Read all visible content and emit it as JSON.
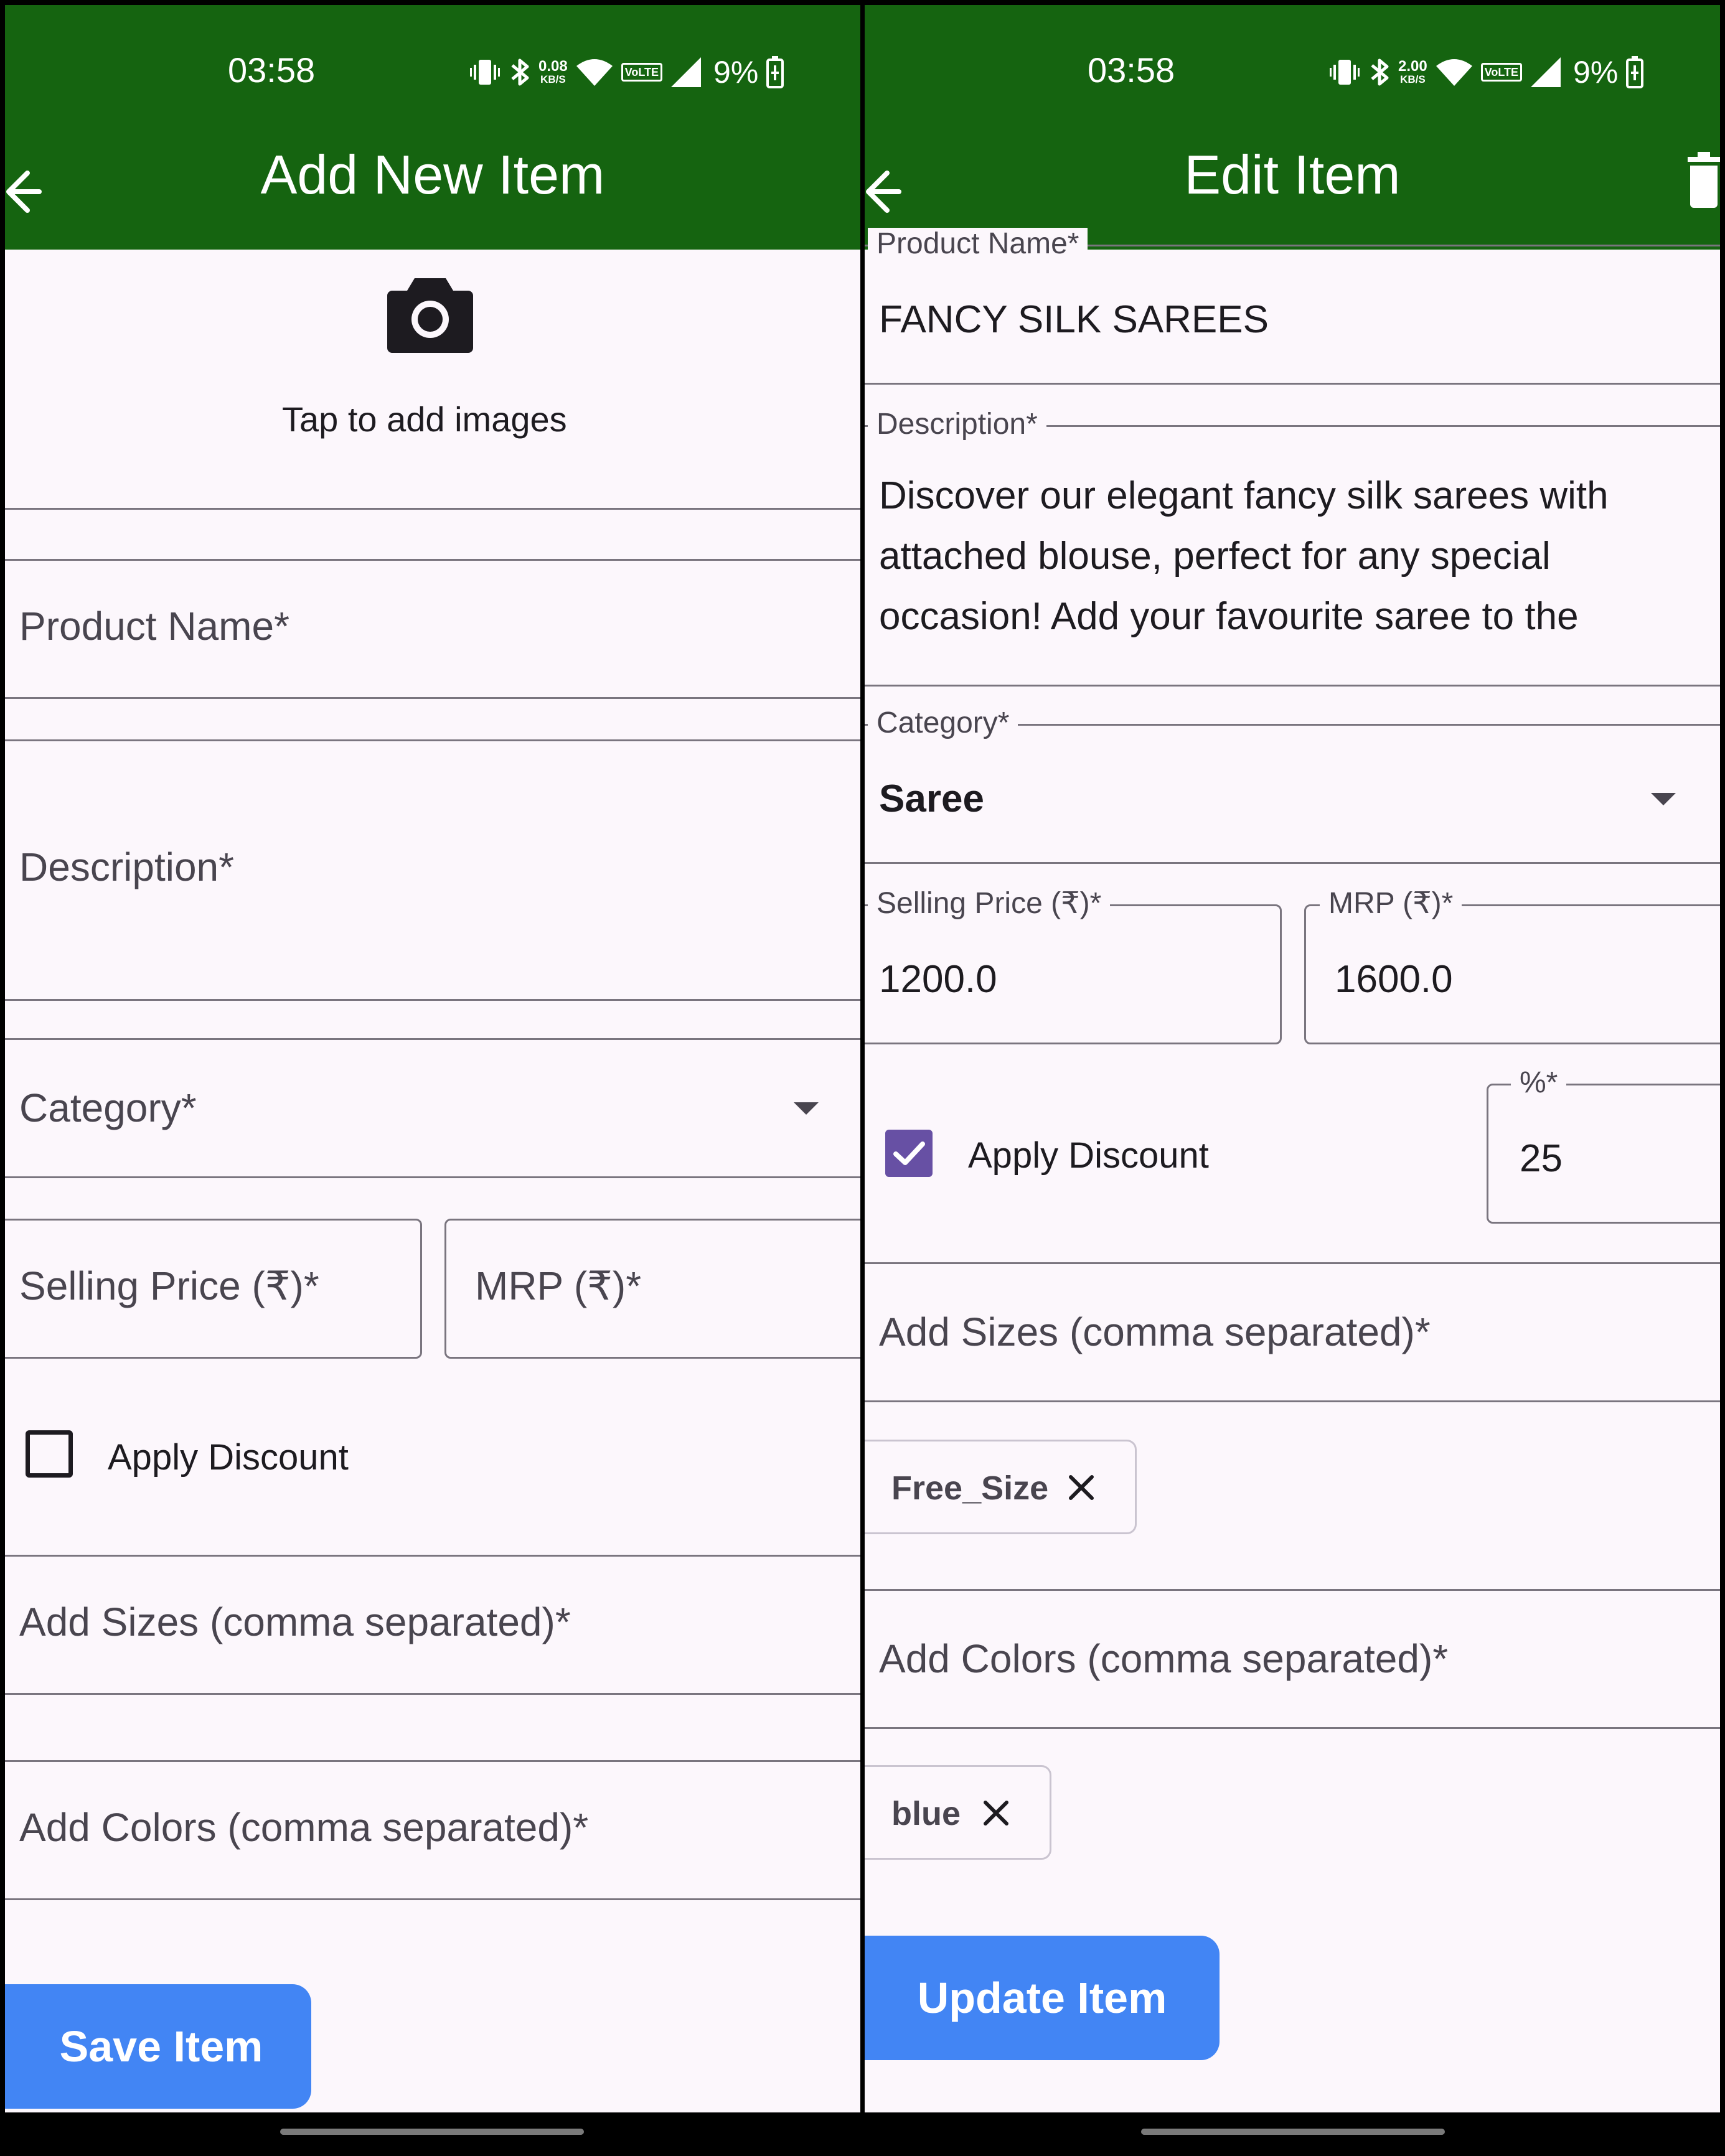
{
  "status_bar": {
    "time": "03:58",
    "left_speed": {
      "value": "0.08",
      "unit": "KB/S"
    },
    "right_speed": {
      "value": "2.00",
      "unit": "KB/S"
    },
    "volte": "VoLTE",
    "battery": "9%",
    "icons": [
      "vibrate-icon",
      "bluetooth-icon",
      "wifi-icon",
      "volte-icon",
      "signal-icon",
      "battery-icon"
    ]
  },
  "add_screen": {
    "title": "Add New Item",
    "image_hint": "Tap to add images",
    "product_name_placeholder": "Product Name*",
    "description_placeholder": "Description*",
    "category_placeholder": "Category*",
    "selling_price_placeholder": "Selling Price (₹)*",
    "mrp_placeholder": "MRP (₹)*",
    "apply_discount_label": "Apply Discount",
    "apply_discount_checked": false,
    "sizes_placeholder": "Add Sizes (comma separated)*",
    "colors_placeholder": "Add Colors (comma separated)*",
    "save_button": "Save Item"
  },
  "edit_screen": {
    "title": "Edit Item",
    "product_name_label": "Product Name*",
    "product_name_value": "FANCY SILK SAREES",
    "description_label": "Description*",
    "description_lines": [
      "Discover our elegant fancy silk sarees with",
      "attached blouse, perfect for any special",
      "occasion! Add your favourite saree to the"
    ],
    "category_label": "Category*",
    "category_value": "Saree",
    "selling_price_label": "Selling Price (₹)*",
    "selling_price_value": "1200.0",
    "mrp_label": "MRP (₹)*",
    "mrp_value": "1600.0",
    "apply_discount_label": "Apply Discount",
    "apply_discount_checked": true,
    "discount_label": "%*",
    "discount_value": "25",
    "sizes_placeholder": "Add Sizes (comma separated)*",
    "size_chips": [
      "Free_Size"
    ],
    "colors_placeholder": "Add Colors (comma separated)*",
    "color_chips": [
      "blue"
    ],
    "update_button": "Update Item"
  },
  "colors": {
    "app_bar": "#156410",
    "button": "#4285f4",
    "checkbox_checked": "#6750a4",
    "background": "#fcf7fc"
  }
}
